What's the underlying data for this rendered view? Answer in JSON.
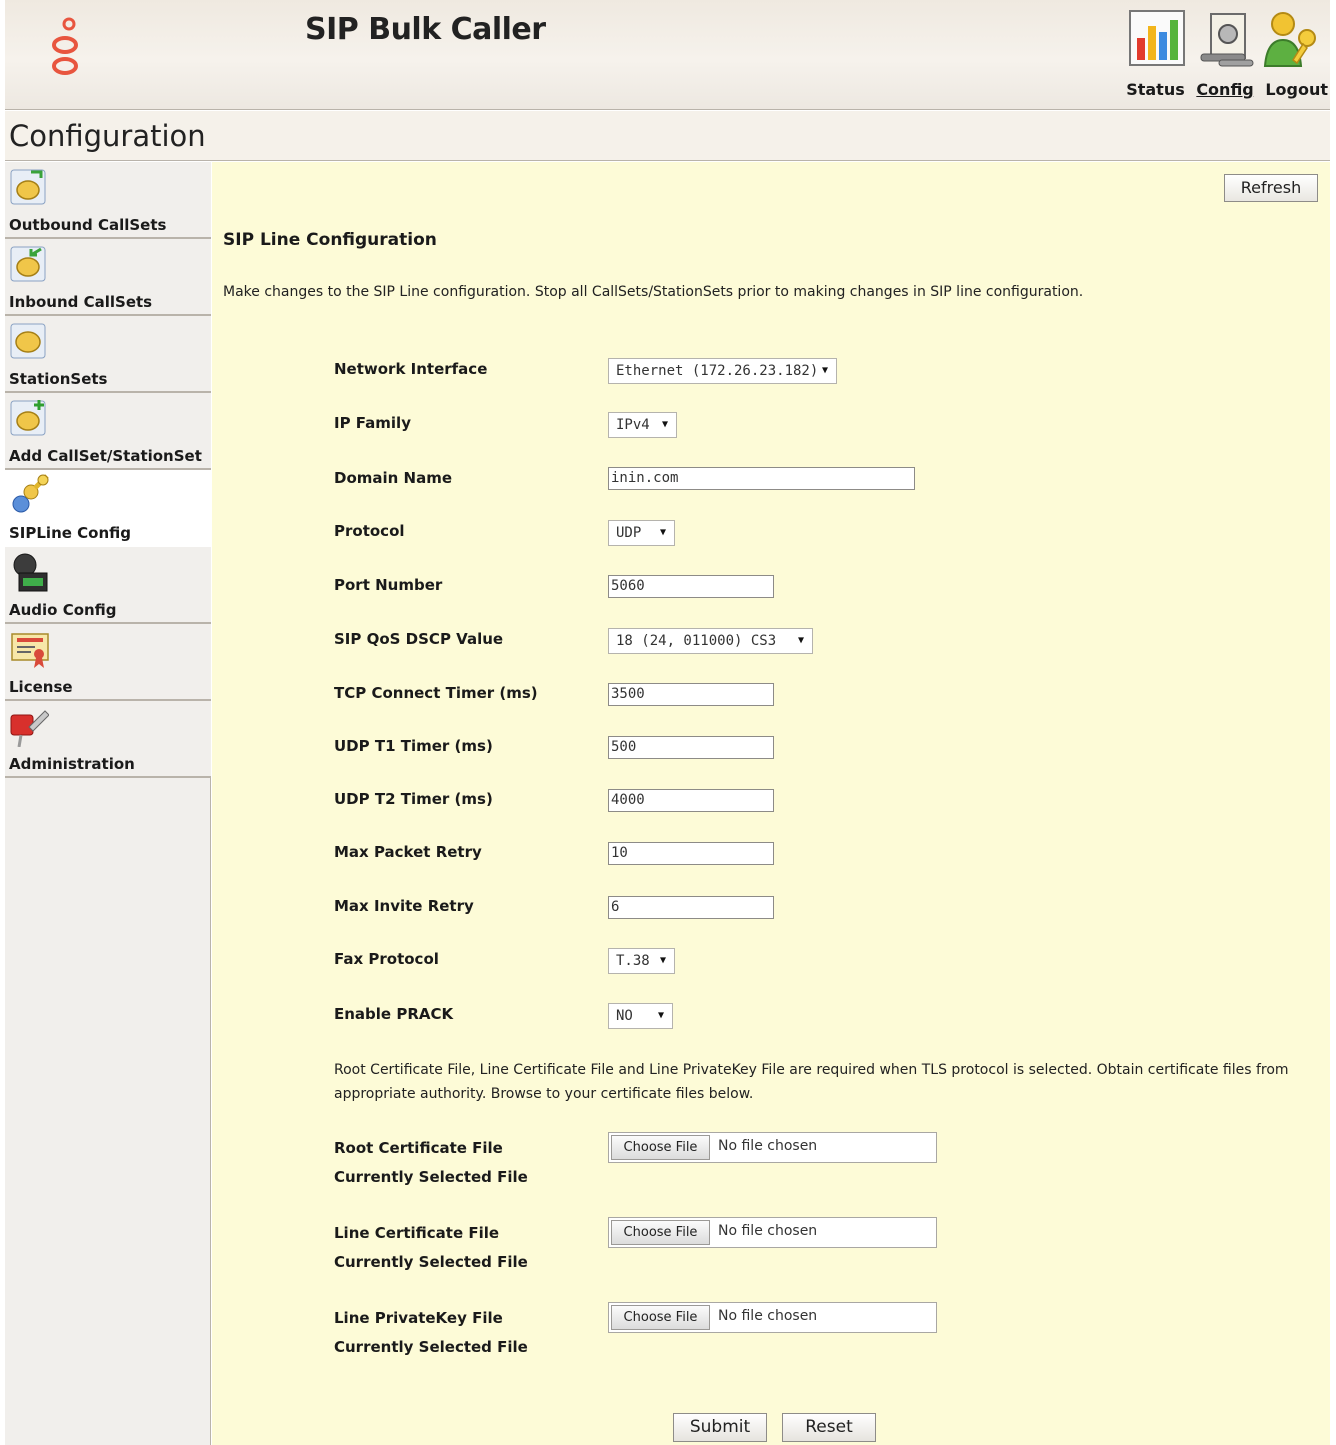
{
  "header": {
    "app_title": "SIP Bulk Caller",
    "links": {
      "status": "Status",
      "config": "Config",
      "logout": "Logout"
    }
  },
  "page": {
    "title": "Configuration"
  },
  "sidebar": {
    "items": [
      {
        "label": "Outbound CallSets",
        "icon": "outbound-callsets-icon"
      },
      {
        "label": "Inbound CallSets",
        "icon": "inbound-callsets-icon"
      },
      {
        "label": "StationSets",
        "icon": "stationsets-icon"
      },
      {
        "label": "Add CallSet/StationSet",
        "icon": "add-callset-icon"
      },
      {
        "label": "SIPLine Config",
        "icon": "sipline-config-icon",
        "active": true
      },
      {
        "label": "Audio Config",
        "icon": "audio-config-icon"
      },
      {
        "label": "License",
        "icon": "license-icon"
      },
      {
        "label": "Administration",
        "icon": "administration-icon"
      }
    ]
  },
  "main": {
    "refresh_label": "Refresh",
    "section_title": "SIP Line Configuration",
    "intro": "Make changes to the SIP Line configuration. Stop all CallSets/StationSets prior to making changes in SIP line configuration.",
    "fields": {
      "network_interface": {
        "label": "Network Interface",
        "value": "Ethernet (172.26.23.182)"
      },
      "ip_family": {
        "label": "IP Family",
        "value": "IPv4"
      },
      "domain_name": {
        "label": "Domain Name",
        "value": "inin.com"
      },
      "protocol": {
        "label": "Protocol",
        "value": "UDP"
      },
      "port_number": {
        "label": "Port Number",
        "value": "5060"
      },
      "sip_qos": {
        "label": "SIP QoS DSCP Value",
        "value": "18 (24, 011000) CS3"
      },
      "tcp_timer": {
        "label": "TCP Connect Timer (ms)",
        "value": "3500"
      },
      "udp_t1": {
        "label": "UDP T1 Timer (ms)",
        "value": "500"
      },
      "udp_t2": {
        "label": "UDP T2 Timer (ms)",
        "value": "4000"
      },
      "max_packet_retry": {
        "label": "Max Packet Retry",
        "value": "10"
      },
      "max_invite_retry": {
        "label": "Max Invite Retry",
        "value": "6"
      },
      "fax_protocol": {
        "label": "Fax Protocol",
        "value": "T.38"
      },
      "enable_prack": {
        "label": "Enable PRACK",
        "value": "NO"
      }
    },
    "tls_note": "Root Certificate File, Line Certificate File and Line PrivateKey File are required when TLS protocol is selected. Obtain certificate files from appropriate authority. Browse to your certificate files below.",
    "files": {
      "root_cert": {
        "label": "Root Certificate File",
        "selected_label": "Currently Selected File"
      },
      "line_cert": {
        "label": "Line Certificate File",
        "selected_label": "Currently Selected File"
      },
      "line_key": {
        "label": "Line PrivateKey File",
        "selected_label": "Currently Selected File"
      },
      "choose_label": "Choose File",
      "no_file_text": "No file chosen"
    },
    "submit_label": "Submit",
    "reset_label": "Reset"
  }
}
